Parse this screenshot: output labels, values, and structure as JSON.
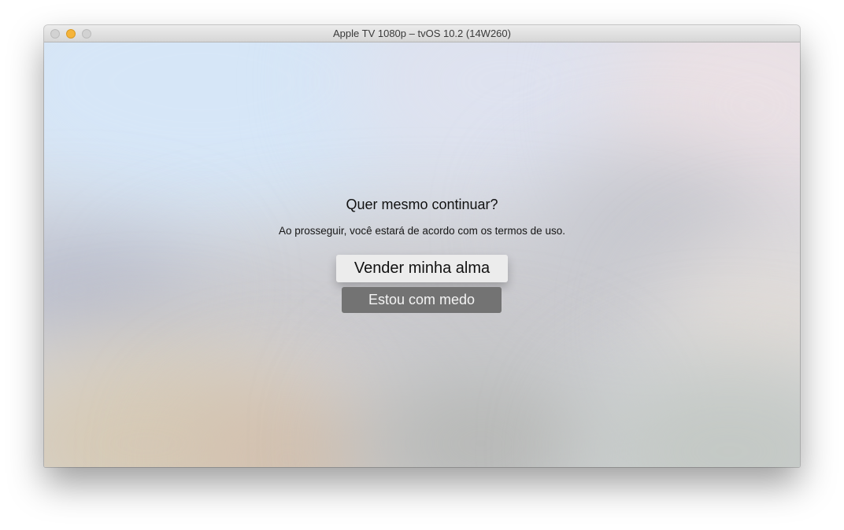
{
  "window": {
    "title": "Apple TV 1080p – tvOS 10.2 (14W260)",
    "controls": [
      "close",
      "minimize",
      "zoom"
    ]
  },
  "dialog": {
    "title": "Quer mesmo continuar?",
    "message": "Ao prosseguir, você estará de acordo com os termos de uso.",
    "primary_button": "Vender minha alma",
    "secondary_button": "Estou com medo"
  },
  "colors": {
    "minimize": "#f5b43a",
    "focused_button_bg": "#ececec",
    "unfocused_button_bg": "#737373"
  }
}
